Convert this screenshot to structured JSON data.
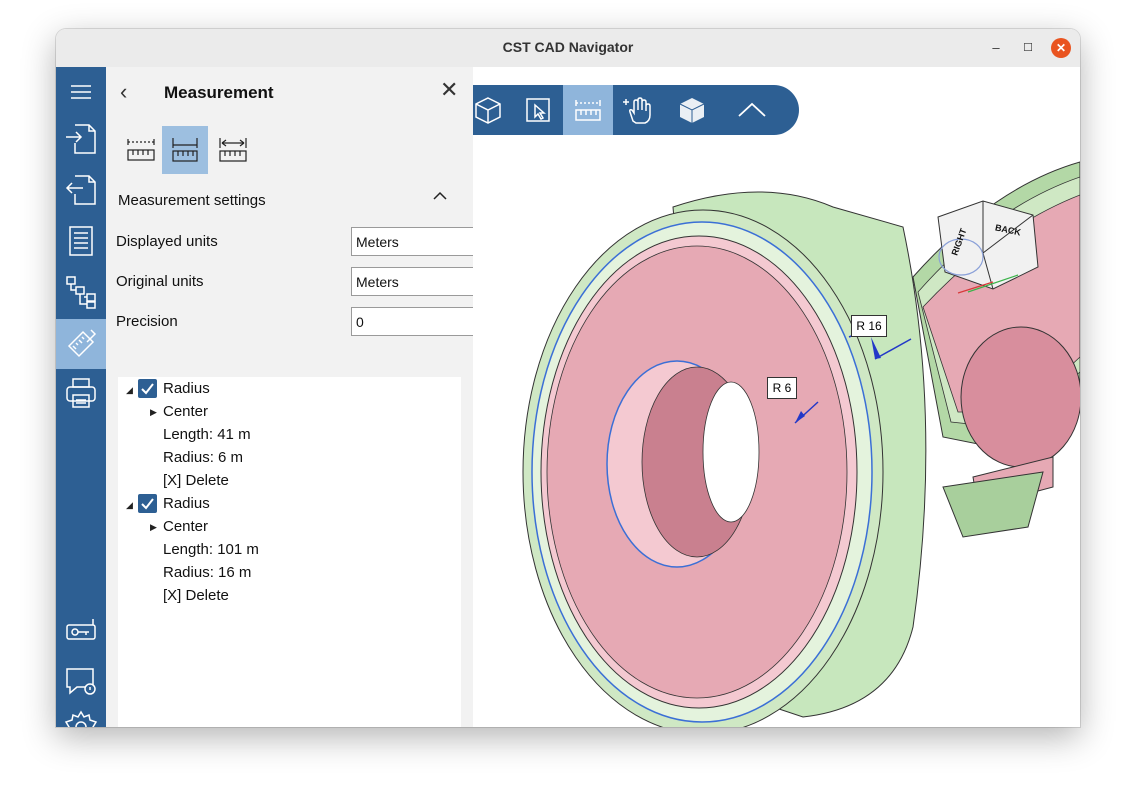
{
  "window": {
    "title": "CST CAD Navigator",
    "minimize": "–",
    "maximize": "☐",
    "close": "✕"
  },
  "panel": {
    "back": "‹",
    "title": "Measurement",
    "close": "✕",
    "section_title": "Measurement settings",
    "settings": [
      {
        "label": "Displayed units",
        "value": "Meters"
      },
      {
        "label": "Original units",
        "value": "Meters"
      },
      {
        "label": "Precision",
        "value": "0"
      }
    ],
    "measurements": [
      {
        "name": "Radius",
        "center": "Center",
        "length": "Length: 41 m",
        "radius": "Radius: 6 m",
        "delete": "[X] Delete"
      },
      {
        "name": "Radius",
        "center": "Center",
        "length": "Length: 101 m",
        "radius": "Radius: 16 m",
        "delete": "[X] Delete"
      }
    ]
  },
  "viewport": {
    "labels": [
      "R 16",
      "R 6"
    ],
    "view_cube": {
      "right": "RIGHT",
      "back": "BACK"
    }
  },
  "colors": {
    "rail": "#2d5f93",
    "active": "#8fb5db",
    "ring_green": "#cfe8c4",
    "face_pink": "#e8adb7"
  }
}
